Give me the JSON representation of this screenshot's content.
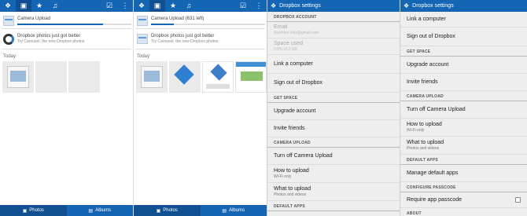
{
  "photos_panel_1": {
    "camera_upload": {
      "title": "Camera Upload",
      "progress": 0.75
    },
    "carousel": {
      "title": "Dropbox photos just got better",
      "subtitle": "Try Carousel, the new Dropbox photos"
    },
    "section": "Today",
    "tabs": {
      "photos": "Photos",
      "albums": "Albums"
    }
  },
  "photos_panel_2": {
    "camera_upload": {
      "title": "Camera Upload (631 left)",
      "progress": 0.2
    },
    "carousel": {
      "title": "Dropbox photos just got better",
      "subtitle": "Try Carousel, the new Dropbox photos"
    },
    "section": "Today",
    "tabs": {
      "photos": "Photos",
      "albums": "Albums"
    }
  },
  "settings_panel_1": {
    "title": "Dropbox settings",
    "account_header": "DROPBOX ACCOUNT",
    "email_label": "Email",
    "email_value": "thanhhm.bkis@gmail.com",
    "space_label": "Space used",
    "space_value": "0.0% of 2 GB",
    "link_computer": "Link a computer",
    "sign_out": "Sign out of Dropbox",
    "get_space_header": "GET SPACE",
    "upgrade": "Upgrade account",
    "invite": "Invite friends",
    "camera_header": "CAMERA UPLOAD",
    "turn_off": "Turn off Camera Upload",
    "how_upload": "How to upload",
    "how_upload_value": "Wi-Fi only",
    "what_upload": "What to upload",
    "what_upload_value": "Photos and videos",
    "default_apps_header": "DEFAULT APPS"
  },
  "settings_panel_2": {
    "title": "Dropbox settings",
    "link_computer": "Link a computer",
    "sign_out": "Sign out of Dropbox",
    "get_space_header": "GET SPACE",
    "upgrade": "Upgrade account",
    "invite": "Invite friends",
    "camera_header": "CAMERA UPLOAD",
    "turn_off": "Turn off Camera Upload",
    "how_upload": "How to upload",
    "how_upload_value": "Wi-Fi only",
    "what_upload": "What to upload",
    "what_upload_value": "Photos and videos",
    "default_apps_header": "DEFAULT APPS",
    "manage_apps": "Manage default apps",
    "passcode_header": "CONFIGURE PASSCODE",
    "require_passcode": "Require app passcode",
    "about_header": "ABOUT"
  },
  "colors": {
    "accent": "#1565b5",
    "accent_dark": "#0f4f92"
  },
  "icons": [
    "dropbox-icon",
    "photos-icon",
    "star-icon",
    "bell-icon",
    "edit-icon",
    "overflow-icon",
    "albums-icon"
  ]
}
